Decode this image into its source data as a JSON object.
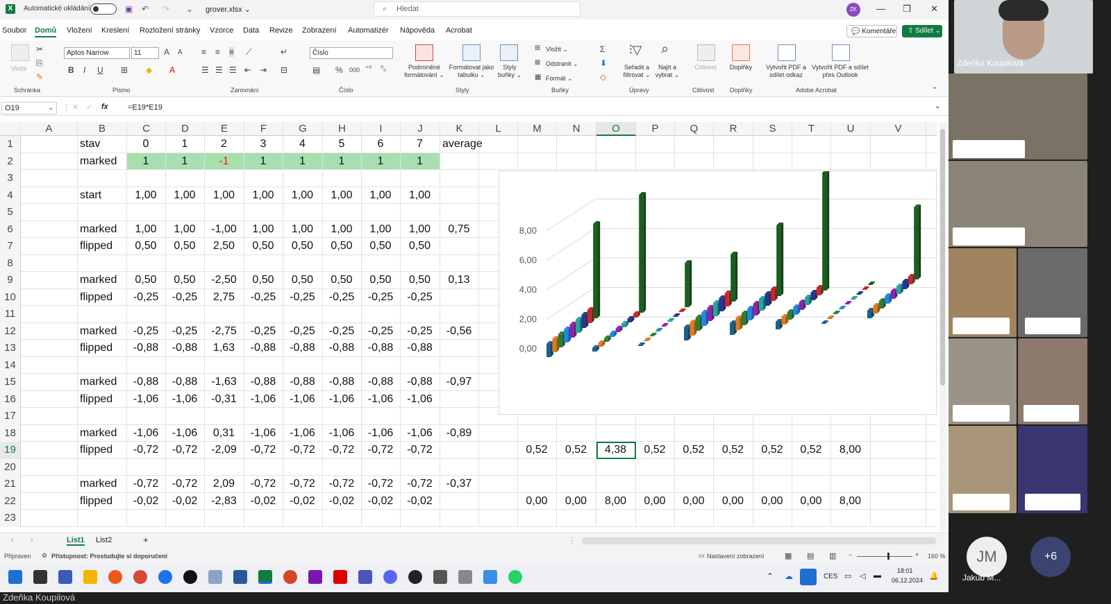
{
  "window": {
    "autosave_label": "Automatické ukládání",
    "filename": "grover.xlsx ⌄",
    "search_placeholder": "Hledat",
    "user_initials": "ZK",
    "min": "—",
    "restore": "❐",
    "close": "✕",
    "undo": "↶",
    "redo": "↷",
    "customize": "⌄"
  },
  "menu": {
    "tabs": [
      "Soubor",
      "Domů",
      "Vložení",
      "Kreslení",
      "Rozložení stránky",
      "Vzorce",
      "Data",
      "Revize",
      "Zobrazení",
      "Automatizér",
      "Nápověda",
      "Acrobat"
    ],
    "comments": "💬 Komentáře",
    "share": "⇧ Sdílet ⌄"
  },
  "ribbon": {
    "paste": "Vložit",
    "clipboard": "Schránka",
    "font_name": "Aptos Narrow",
    "font_size": "11",
    "font_group": "Písmo",
    "alignment": "Zarovnání",
    "number_format": "Číslo",
    "number_group": "Číslo",
    "cond_format": "Podmíněné formátování ⌄",
    "format_table": "Formátovat jako tabulku ⌄",
    "cell_styles": "Styly buňky ⌄",
    "styles_group": "Styly",
    "insert": "Vložit ⌄",
    "delete": "Odstranit ⌄",
    "format": "Formát ⌄",
    "cells_group": "Buňky",
    "sort_filter": "Seřadit a filtrovat ⌄",
    "find_select": "Najít a vybrat ⌄",
    "editing_group": "Úpravy",
    "sensitivity": "Citlivost",
    "sensitivity_group": "Citlivost",
    "addins": "Doplňky",
    "addins_group": "Doplňky",
    "pdf_link": "Vytvořit PDF a sdílet odkaz",
    "pdf_outlook": "Vytvořit PDF a sdílet přes Outlook",
    "acrobat_group": "Adobe Acrobat"
  },
  "formula_bar": {
    "name_box": "O19",
    "fx": "fx",
    "formula": "=E19*E19"
  },
  "columns": [
    "A",
    "B",
    "C",
    "D",
    "E",
    "F",
    "G",
    "H",
    "I",
    "J",
    "K",
    "L",
    "M",
    "N",
    "O",
    "P",
    "Q",
    "R",
    "S",
    "T",
    "U",
    "V"
  ],
  "rows": [
    "1",
    "2",
    "3",
    "4",
    "5",
    "6",
    "7",
    "8",
    "9",
    "10",
    "11",
    "12",
    "13",
    "14",
    "15",
    "16",
    "17",
    "18",
    "19",
    "20",
    "21",
    "22",
    "23"
  ],
  "cells": [
    {
      "row": 1,
      "col": "B",
      "text": "stav"
    },
    {
      "row": 1,
      "col": "C",
      "text": "0"
    },
    {
      "row": 1,
      "col": "D",
      "text": "1"
    },
    {
      "row": 1,
      "col": "E",
      "text": "2"
    },
    {
      "row": 1,
      "col": "F",
      "text": "3"
    },
    {
      "row": 1,
      "col": "G",
      "text": "4"
    },
    {
      "row": 1,
      "col": "H",
      "text": "5"
    },
    {
      "row": 1,
      "col": "I",
      "text": "6"
    },
    {
      "row": 1,
      "col": "J",
      "text": "7"
    },
    {
      "row": 1,
      "col": "K",
      "text": "average"
    },
    {
      "row": 2,
      "col": "B",
      "text": "marked"
    },
    {
      "row": 2,
      "col": "C",
      "text": "1"
    },
    {
      "row": 2,
      "col": "D",
      "text": "1"
    },
    {
      "row": 2,
      "col": "E",
      "text": "-1",
      "color": "#e02020"
    },
    {
      "row": 2,
      "col": "F",
      "text": "1"
    },
    {
      "row": 2,
      "col": "G",
      "text": "1"
    },
    {
      "row": 2,
      "col": "H",
      "text": "1"
    },
    {
      "row": 2,
      "col": "I",
      "text": "1"
    },
    {
      "row": 2,
      "col": "J",
      "text": "1"
    },
    {
      "row": 4,
      "col": "B",
      "text": "start"
    },
    {
      "row": 4,
      "col": "C",
      "text": "1,00"
    },
    {
      "row": 4,
      "col": "D",
      "text": "1,00"
    },
    {
      "row": 4,
      "col": "E",
      "text": "1,00"
    },
    {
      "row": 4,
      "col": "F",
      "text": "1,00"
    },
    {
      "row": 4,
      "col": "G",
      "text": "1,00"
    },
    {
      "row": 4,
      "col": "H",
      "text": "1,00"
    },
    {
      "row": 4,
      "col": "I",
      "text": "1,00"
    },
    {
      "row": 4,
      "col": "J",
      "text": "1,00"
    },
    {
      "row": 6,
      "col": "B",
      "text": "marked"
    },
    {
      "row": 6,
      "col": "C",
      "text": "1,00"
    },
    {
      "row": 6,
      "col": "D",
      "text": "1,00"
    },
    {
      "row": 6,
      "col": "E",
      "text": "-1,00"
    },
    {
      "row": 6,
      "col": "F",
      "text": "1,00"
    },
    {
      "row": 6,
      "col": "G",
      "text": "1,00"
    },
    {
      "row": 6,
      "col": "H",
      "text": "1,00"
    },
    {
      "row": 6,
      "col": "I",
      "text": "1,00"
    },
    {
      "row": 6,
      "col": "J",
      "text": "1,00"
    },
    {
      "row": 6,
      "col": "K",
      "text": "0,75"
    },
    {
      "row": 7,
      "col": "B",
      "text": "flipped"
    },
    {
      "row": 7,
      "col": "C",
      "text": "0,50"
    },
    {
      "row": 7,
      "col": "D",
      "text": "0,50"
    },
    {
      "row": 7,
      "col": "E",
      "text": "2,50"
    },
    {
      "row": 7,
      "col": "F",
      "text": "0,50"
    },
    {
      "row": 7,
      "col": "G",
      "text": "0,50"
    },
    {
      "row": 7,
      "col": "H",
      "text": "0,50"
    },
    {
      "row": 7,
      "col": "I",
      "text": "0,50"
    },
    {
      "row": 7,
      "col": "J",
      "text": "0,50"
    },
    {
      "row": 9,
      "col": "B",
      "text": "marked"
    },
    {
      "row": 9,
      "col": "C",
      "text": "0,50"
    },
    {
      "row": 9,
      "col": "D",
      "text": "0,50"
    },
    {
      "row": 9,
      "col": "E",
      "text": "-2,50"
    },
    {
      "row": 9,
      "col": "F",
      "text": "0,50"
    },
    {
      "row": 9,
      "col": "G",
      "text": "0,50"
    },
    {
      "row": 9,
      "col": "H",
      "text": "0,50"
    },
    {
      "row": 9,
      "col": "I",
      "text": "0,50"
    },
    {
      "row": 9,
      "col": "J",
      "text": "0,50"
    },
    {
      "row": 9,
      "col": "K",
      "text": "0,13"
    },
    {
      "row": 10,
      "col": "B",
      "text": "flipped"
    },
    {
      "row": 10,
      "col": "C",
      "text": "-0,25"
    },
    {
      "row": 10,
      "col": "D",
      "text": "-0,25"
    },
    {
      "row": 10,
      "col": "E",
      "text": "2,75"
    },
    {
      "row": 10,
      "col": "F",
      "text": "-0,25"
    },
    {
      "row": 10,
      "col": "G",
      "text": "-0,25"
    },
    {
      "row": 10,
      "col": "H",
      "text": "-0,25"
    },
    {
      "row": 10,
      "col": "I",
      "text": "-0,25"
    },
    {
      "row": 10,
      "col": "J",
      "text": "-0,25"
    },
    {
      "row": 12,
      "col": "B",
      "text": "marked"
    },
    {
      "row": 12,
      "col": "C",
      "text": "-0,25"
    },
    {
      "row": 12,
      "col": "D",
      "text": "-0,25"
    },
    {
      "row": 12,
      "col": "E",
      "text": "-2,75"
    },
    {
      "row": 12,
      "col": "F",
      "text": "-0,25"
    },
    {
      "row": 12,
      "col": "G",
      "text": "-0,25"
    },
    {
      "row": 12,
      "col": "H",
      "text": "-0,25"
    },
    {
      "row": 12,
      "col": "I",
      "text": "-0,25"
    },
    {
      "row": 12,
      "col": "J",
      "text": "-0,25"
    },
    {
      "row": 12,
      "col": "K",
      "text": "-0,56"
    },
    {
      "row": 13,
      "col": "B",
      "text": "flipped"
    },
    {
      "row": 13,
      "col": "C",
      "text": "-0,88"
    },
    {
      "row": 13,
      "col": "D",
      "text": "-0,88"
    },
    {
      "row": 13,
      "col": "E",
      "text": "1,63"
    },
    {
      "row": 13,
      "col": "F",
      "text": "-0,88"
    },
    {
      "row": 13,
      "col": "G",
      "text": "-0,88"
    },
    {
      "row": 13,
      "col": "H",
      "text": "-0,88"
    },
    {
      "row": 13,
      "col": "I",
      "text": "-0,88"
    },
    {
      "row": 13,
      "col": "J",
      "text": "-0,88"
    },
    {
      "row": 15,
      "col": "B",
      "text": "marked"
    },
    {
      "row": 15,
      "col": "C",
      "text": "-0,88"
    },
    {
      "row": 15,
      "col": "D",
      "text": "-0,88"
    },
    {
      "row": 15,
      "col": "E",
      "text": "-1,63"
    },
    {
      "row": 15,
      "col": "F",
      "text": "-0,88"
    },
    {
      "row": 15,
      "col": "G",
      "text": "-0,88"
    },
    {
      "row": 15,
      "col": "H",
      "text": "-0,88"
    },
    {
      "row": 15,
      "col": "I",
      "text": "-0,88"
    },
    {
      "row": 15,
      "col": "J",
      "text": "-0,88"
    },
    {
      "row": 15,
      "col": "K",
      "text": "-0,97"
    },
    {
      "row": 16,
      "col": "B",
      "text": "flipped"
    },
    {
      "row": 16,
      "col": "C",
      "text": "-1,06"
    },
    {
      "row": 16,
      "col": "D",
      "text": "-1,06"
    },
    {
      "row": 16,
      "col": "E",
      "text": "-0,31"
    },
    {
      "row": 16,
      "col": "F",
      "text": "-1,06"
    },
    {
      "row": 16,
      "col": "G",
      "text": "-1,06"
    },
    {
      "row": 16,
      "col": "H",
      "text": "-1,06"
    },
    {
      "row": 16,
      "col": "I",
      "text": "-1,06"
    },
    {
      "row": 16,
      "col": "J",
      "text": "-1,06"
    },
    {
      "row": 18,
      "col": "B",
      "text": "marked"
    },
    {
      "row": 18,
      "col": "C",
      "text": "-1,06"
    },
    {
      "row": 18,
      "col": "D",
      "text": "-1,06"
    },
    {
      "row": 18,
      "col": "E",
      "text": "0,31"
    },
    {
      "row": 18,
      "col": "F",
      "text": "-1,06"
    },
    {
      "row": 18,
      "col": "G",
      "text": "-1,06"
    },
    {
      "row": 18,
      "col": "H",
      "text": "-1,06"
    },
    {
      "row": 18,
      "col": "I",
      "text": "-1,06"
    },
    {
      "row": 18,
      "col": "J",
      "text": "-1,06"
    },
    {
      "row": 18,
      "col": "K",
      "text": "-0,89"
    },
    {
      "row": 19,
      "col": "B",
      "text": "flipped"
    },
    {
      "row": 19,
      "col": "C",
      "text": "-0,72"
    },
    {
      "row": 19,
      "col": "D",
      "text": "-0,72"
    },
    {
      "row": 19,
      "col": "E",
      "text": "-2,09"
    },
    {
      "row": 19,
      "col": "F",
      "text": "-0,72"
    },
    {
      "row": 19,
      "col": "G",
      "text": "-0,72"
    },
    {
      "row": 19,
      "col": "H",
      "text": "-0,72"
    },
    {
      "row": 19,
      "col": "I",
      "text": "-0,72"
    },
    {
      "row": 19,
      "col": "J",
      "text": "-0,72"
    },
    {
      "row": 19,
      "col": "M",
      "text": "0,52"
    },
    {
      "row": 19,
      "col": "N",
      "text": "0,52"
    },
    {
      "row": 19,
      "col": "O",
      "text": "4,38"
    },
    {
      "row": 19,
      "col": "P",
      "text": "0,52"
    },
    {
      "row": 19,
      "col": "Q",
      "text": "0,52"
    },
    {
      "row": 19,
      "col": "R",
      "text": "0,52"
    },
    {
      "row": 19,
      "col": "S",
      "text": "0,52"
    },
    {
      "row": 19,
      "col": "T",
      "text": "0,52"
    },
    {
      "row": 19,
      "col": "U",
      "text": "8,00"
    },
    {
      "row": 21,
      "col": "B",
      "text": "marked"
    },
    {
      "row": 21,
      "col": "C",
      "text": "-0,72"
    },
    {
      "row": 21,
      "col": "D",
      "text": "-0,72"
    },
    {
      "row": 21,
      "col": "E",
      "text": "2,09"
    },
    {
      "row": 21,
      "col": "F",
      "text": "-0,72"
    },
    {
      "row": 21,
      "col": "G",
      "text": "-0,72"
    },
    {
      "row": 21,
      "col": "H",
      "text": "-0,72"
    },
    {
      "row": 21,
      "col": "I",
      "text": "-0,72"
    },
    {
      "row": 21,
      "col": "J",
      "text": "-0,72"
    },
    {
      "row": 21,
      "col": "K",
      "text": "-0,37"
    },
    {
      "row": 22,
      "col": "B",
      "text": "flipped"
    },
    {
      "row": 22,
      "col": "C",
      "text": "-0,02"
    },
    {
      "row": 22,
      "col": "D",
      "text": "-0,02"
    },
    {
      "row": 22,
      "col": "E",
      "text": "-2,83"
    },
    {
      "row": 22,
      "col": "F",
      "text": "-0,02"
    },
    {
      "row": 22,
      "col": "G",
      "text": "-0,02"
    },
    {
      "row": 22,
      "col": "H",
      "text": "-0,02"
    },
    {
      "row": 22,
      "col": "I",
      "text": "-0,02"
    },
    {
      "row": 22,
      "col": "J",
      "text": "-0,02"
    },
    {
      "row": 22,
      "col": "M",
      "text": "0,00"
    },
    {
      "row": 22,
      "col": "N",
      "text": "0,00"
    },
    {
      "row": 22,
      "col": "O",
      "text": "8,00"
    },
    {
      "row": 22,
      "col": "P",
      "text": "0,00"
    },
    {
      "row": 22,
      "col": "Q",
      "text": "0,00"
    },
    {
      "row": 22,
      "col": "R",
      "text": "0,00"
    },
    {
      "row": 22,
      "col": "S",
      "text": "0,00"
    },
    {
      "row": 22,
      "col": "T",
      "text": "0,00"
    },
    {
      "row": 22,
      "col": "U",
      "text": "8,00"
    }
  ],
  "chart_data": {
    "type": "bar",
    "subtype": "3d-column",
    "ylim": [
      0,
      8
    ],
    "yticks": [
      "0,00",
      "2,00",
      "4,00",
      "6,00",
      "8,00"
    ],
    "grid": true,
    "series_colors": [
      "#1f5f8b",
      "#e07a1f",
      "#2e7d32",
      "#1e88e5",
      "#8e24aa",
      "#26a69a",
      "#283593",
      "#c62828",
      "#1b5e20"
    ],
    "groups": [
      [
        0.9,
        0.9,
        0.9,
        0.9,
        0.9,
        0.9,
        0.9,
        0.9,
        6.4
      ],
      [
        0.25,
        0.25,
        0.25,
        0.25,
        0.25,
        0.25,
        0.25,
        0.25,
        8.0
      ],
      [
        0.06,
        0.06,
        0.06,
        0.06,
        0.06,
        0.06,
        0.06,
        0.06,
        3.0
      ],
      [
        0.9,
        0.9,
        0.9,
        0.9,
        0.9,
        0.9,
        0.9,
        0.9,
        3.2
      ],
      [
        0.8,
        0.8,
        0.8,
        0.8,
        0.8,
        0.8,
        0.8,
        0.8,
        4.8
      ],
      [
        0.52,
        0.52,
        0.52,
        0.52,
        0.52,
        0.52,
        0.52,
        0.52,
        8.0
      ],
      [
        0.02,
        0.02,
        0.02,
        0.02,
        0.02,
        0.02,
        0.02,
        0.02,
        0.02
      ],
      [
        0.52,
        0.52,
        0.52,
        0.52,
        0.52,
        0.52,
        0.52,
        0.52,
        4.9
      ]
    ]
  },
  "sheets": {
    "tabs": [
      "List1",
      "List2"
    ],
    "add": "+",
    "prev": "‹",
    "next": "›"
  },
  "status": {
    "ready": "Připraven",
    "accessibility": "Přístupnost: Prostudujte si doporučení",
    "view_settings": "Nastavení zobrazení",
    "zoom": "160 %"
  },
  "taskbar": {
    "lang": "CES",
    "time": "18:01",
    "date": "06.12.2024"
  },
  "meeting": {
    "presenter": "Zdeňka Koupilová",
    "attendee_initials": "JM",
    "attendee_name": "Jakub M...",
    "more": "+6",
    "bottom_name": "Zdeňka Koupilová"
  }
}
